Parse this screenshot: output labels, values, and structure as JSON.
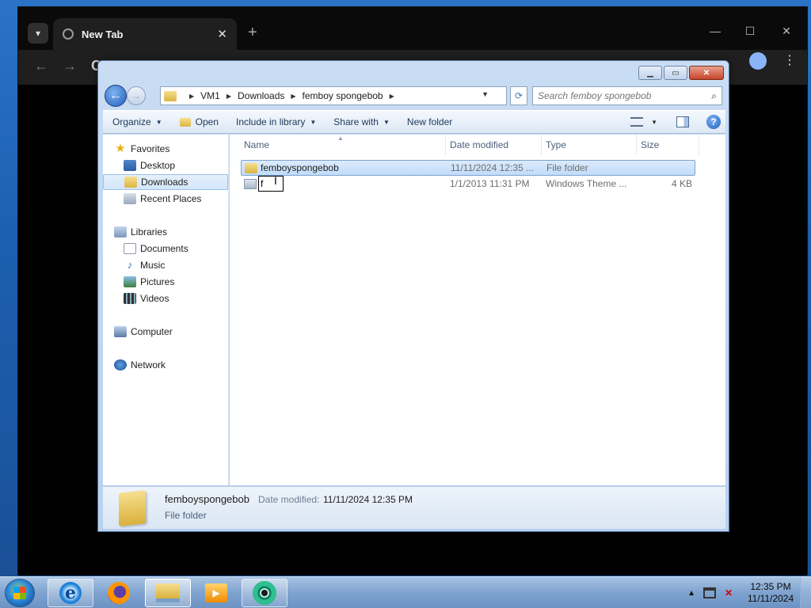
{
  "browser": {
    "tab_title": "New Tab",
    "omnibox_letter": "C",
    "new_tab_symbol": "+",
    "tab_close_symbol": "✕",
    "minimize_symbol": "—",
    "maximize_symbol": "☐",
    "close_symbol": "✕"
  },
  "explorer": {
    "breadcrumb": [
      "VM1",
      "Downloads",
      "femboy spongebob"
    ],
    "search_placeholder": "Search femboy spongebob",
    "toolbar": {
      "organize": "Organize",
      "open": "Open",
      "include_in_library": "Include in library",
      "share_with": "Share with",
      "new_folder": "New folder",
      "help": "?"
    },
    "nav": {
      "favorites": "Favorites",
      "desktop": "Desktop",
      "downloads": "Downloads",
      "recent_places": "Recent Places",
      "libraries": "Libraries",
      "documents": "Documents",
      "music": "Music",
      "pictures": "Pictures",
      "videos": "Videos",
      "computer": "Computer",
      "network": "Network"
    },
    "columns": {
      "name": "Name",
      "date_modified": "Date modified",
      "type": "Type",
      "size": "Size"
    },
    "files": [
      {
        "name": "femboyspongebob",
        "date": "11/11/2024 12:35 ...",
        "type": "File folder",
        "size": ""
      },
      {
        "name": "f",
        "date": "1/1/2013 11:31 PM",
        "type": "Windows Theme ...",
        "size": "4 KB"
      }
    ],
    "details": {
      "name": "femboyspongebob",
      "date_label": "Date modified:",
      "date_value": "11/11/2024 12:35 PM",
      "type": "File folder"
    }
  },
  "taskbar": {
    "time": "12:35 PM",
    "date": "11/11/2024"
  },
  "colors": {
    "selection": "#c1dcfb",
    "taskbar": "#7fa3cf",
    "chrome_bg": "#000000"
  }
}
